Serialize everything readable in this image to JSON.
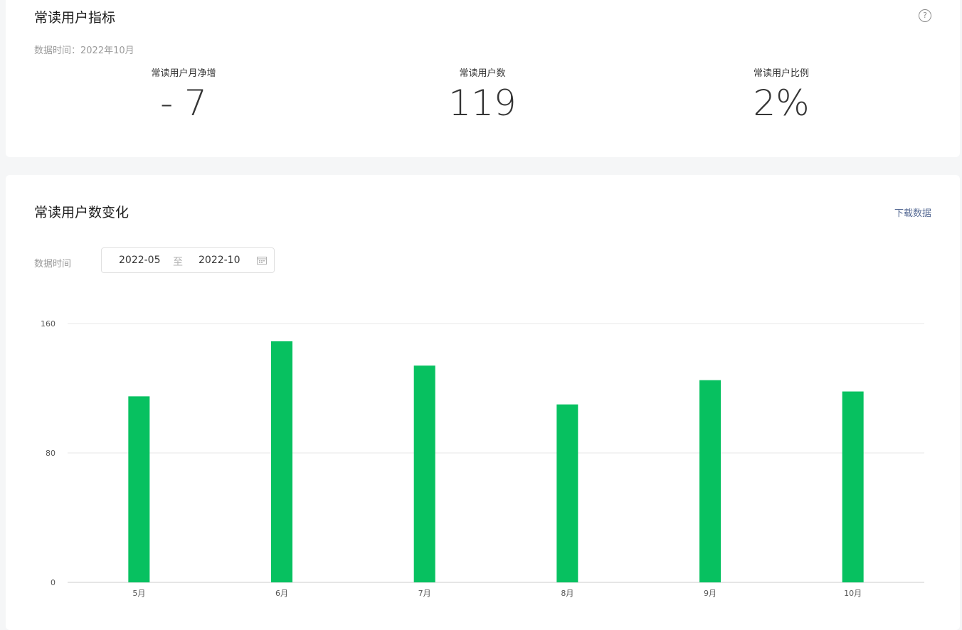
{
  "metrics_card": {
    "title": "常读用户指标",
    "help_glyph": "?",
    "data_time": "数据时间：2022年10月",
    "metrics": [
      {
        "label": "常读用户月净增",
        "value": "- 7"
      },
      {
        "label": "常读用户数",
        "value": "119"
      },
      {
        "label": "常读用户比例",
        "value": "2%"
      }
    ]
  },
  "chart_card": {
    "title": "常读用户数变化",
    "download_label": "下载数据",
    "range_label": "数据时间",
    "range_start": "2022-05",
    "range_separator": "至",
    "range_end": "2022-10",
    "calendar_icon": "calendar-icon"
  },
  "colors": {
    "bar": "#07c160",
    "link": "#576b95",
    "grid": "#e7e7e7"
  },
  "chart_data": {
    "type": "bar",
    "categories": [
      "5月",
      "6月",
      "7月",
      "8月",
      "9月",
      "10月"
    ],
    "values": [
      115,
      149,
      134,
      110,
      125,
      118
    ],
    "ylim": [
      0,
      160
    ],
    "yticks": [
      0,
      80,
      160
    ],
    "grid": true,
    "legend": "none",
    "title": "",
    "xlabel": "",
    "ylabel": ""
  }
}
